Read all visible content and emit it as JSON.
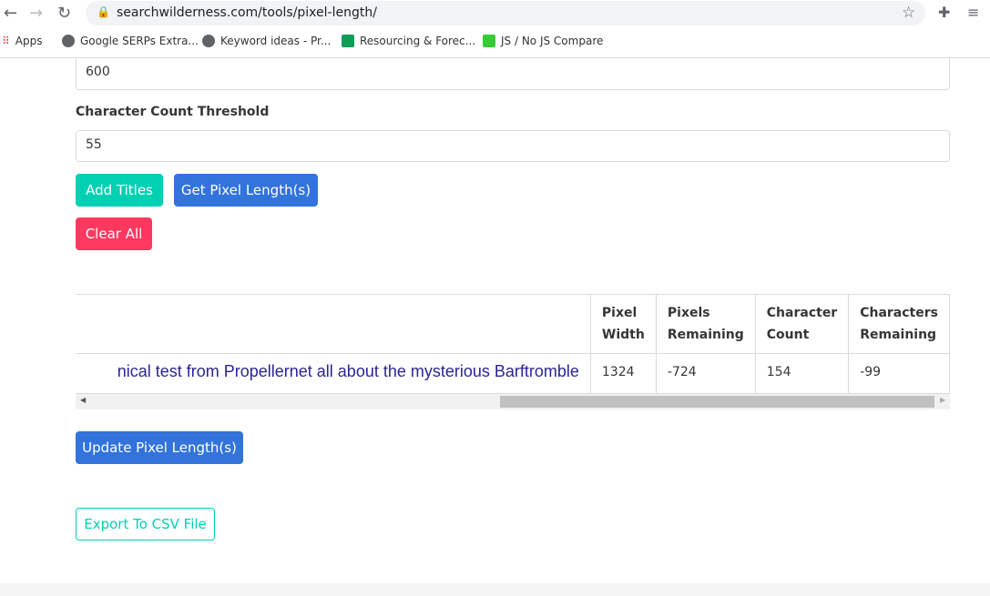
{
  "browser": {
    "url": "searchwilderness.com/tools/pixel-length/",
    "bookmarks": [
      "Apps",
      "Google SERPs Extra...",
      "Keyword ideas - Pr...",
      "Resourcing & Forec...",
      "JS / No JS Compare"
    ]
  },
  "form": {
    "pixel_threshold_value": "600",
    "char_threshold_label": "Character Count Threshold",
    "char_threshold_value": "55",
    "add_titles": "Add Titles",
    "get_pixel": "Get Pixel Length(s)",
    "clear_all": "Clear All"
  },
  "table": {
    "headers": [
      "",
      "Pixel Width",
      "Pixels Remaining",
      "Character Count",
      "Characters Remaining"
    ],
    "rows": [
      {
        "title": "nical test from Propellernet all about the mysterious Barftromble",
        "pixel_width": "1324",
        "pixels_remaining": "-724",
        "character_count": "154",
        "characters_remaining": "-99"
      }
    ]
  },
  "actions": {
    "update": "Update Pixel Length(s)",
    "export": "Export To CSV File"
  },
  "colors": {
    "primary": "#3273dc",
    "success": "#00d1b2",
    "danger": "#ff3860",
    "link": "#2a2595"
  }
}
